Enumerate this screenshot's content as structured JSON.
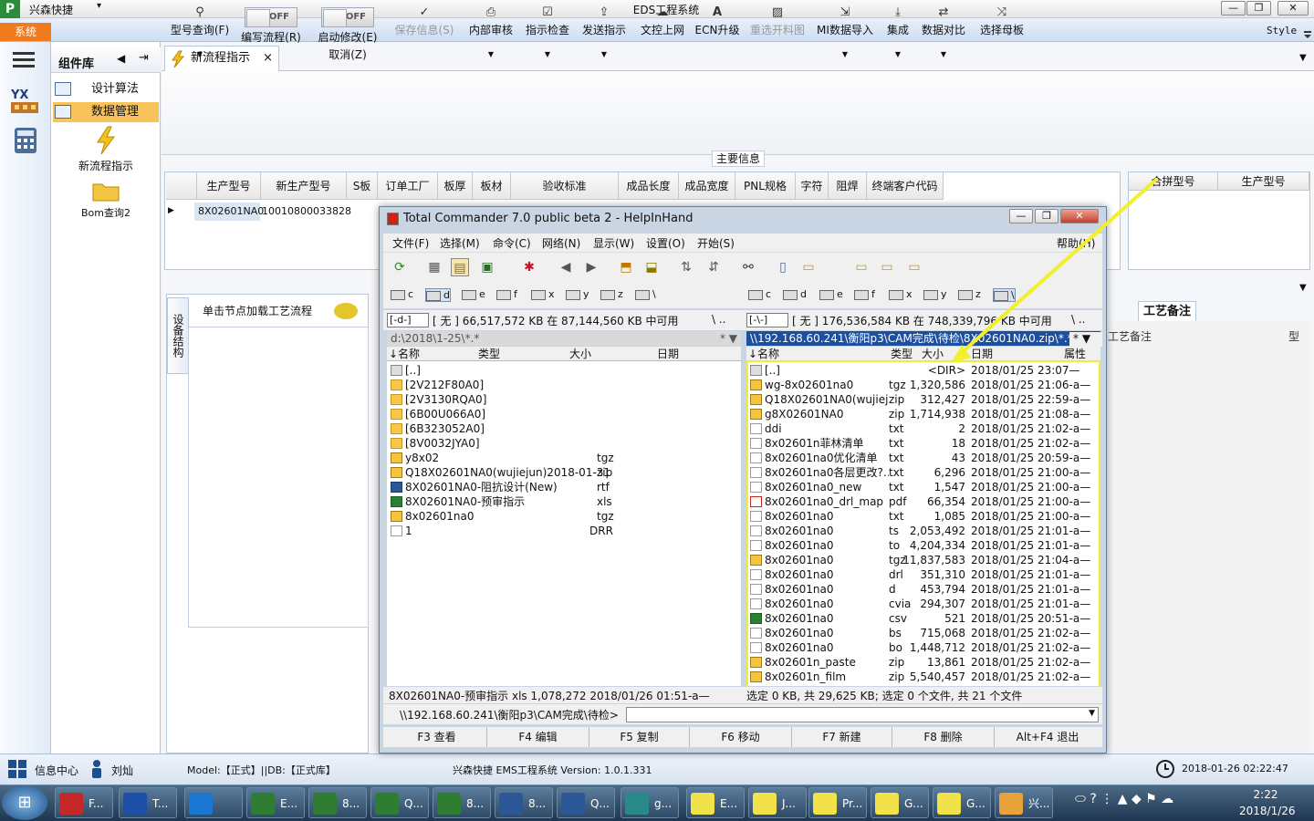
{
  "app": {
    "name": "兴森快捷",
    "window_title": "EDS工程系统",
    "qat": "▾",
    "system_tab": "系统",
    "style_label": "Style"
  },
  "window_buttons": {
    "min": "—",
    "max": "❐",
    "close": "✕"
  },
  "component_panel": {
    "title": "组件库",
    "items": [
      {
        "label": "设计算法"
      },
      {
        "label": "数据管理"
      }
    ],
    "big_items": [
      {
        "label": "新流程指示"
      },
      {
        "label": "Bom查询2"
      }
    ]
  },
  "doc_tab": {
    "label": "新流程指示",
    "close": "×"
  },
  "ribbon": {
    "items": [
      {
        "icon": "search-icon",
        "label": "型号查询(F)"
      },
      {
        "icon": "toggle",
        "label": "编写流程(R)",
        "toggle": "OFF"
      },
      {
        "icon": "toggle",
        "label": "启动修改(E)",
        "label2": "取消(Z)",
        "toggle": "OFF"
      },
      {
        "icon": "check-icon",
        "label": "保存信息(S)"
      },
      {
        "icon": "printer-icon",
        "label": "内部审核"
      },
      {
        "icon": "checkbox-icon",
        "label": "指示检查"
      },
      {
        "icon": "upload-icon",
        "label": "发送指示"
      },
      {
        "icon": "cloud-upload-icon",
        "label": "文控上网"
      },
      {
        "icon": "font-icon",
        "label": "ECN升级"
      },
      {
        "icon": "image-icon",
        "label": "重选开料图"
      },
      {
        "icon": "import-icon",
        "label": "MI数据导入"
      },
      {
        "icon": "download-icon",
        "label": "集成"
      },
      {
        "icon": "compare-icon",
        "label": "数据对比"
      },
      {
        "icon": "shuffle-icon",
        "label": "选择母板"
      }
    ]
  },
  "main_info_label": "主要信息",
  "grid": {
    "headers": [
      "生产型号",
      "新生产型号",
      "S板",
      "订单工厂",
      "板厚",
      "板材",
      "验收标准",
      "成品长度",
      "成品宽度",
      "PNL规格",
      "字符",
      "阻焊",
      "终端客户代码"
    ],
    "row": [
      "8X02601NA0",
      "10010800033828"
    ]
  },
  "right_grid": {
    "headers": [
      "合拼型号",
      "生产型号"
    ]
  },
  "lower": {
    "vertical_tab": "设备结构",
    "hint": "单击节点加载工艺流程",
    "process_tab": "工艺备注",
    "remark_label": "工艺备注",
    "xing": "型"
  },
  "status": {
    "info_center": "信息中心",
    "user": "刘灿",
    "model": "Model:【正式】||DB:【正式库】",
    "version": "兴森快捷 EMS工程系统 Version: 1.0.1.331",
    "datetime": "2018-01-26 02:22:47"
  },
  "tc": {
    "title": "Total Commander 7.0 public beta 2 - HelpInHand",
    "menu": [
      "文件(F)",
      "选择(M)",
      "命令(C)",
      "网络(N)",
      "显示(W)",
      "设置(O)",
      "开始(S)"
    ],
    "help": "帮助(H)",
    "drives_left": [
      "c",
      "d",
      "e",
      "f",
      "x",
      "y",
      "z",
      "\\"
    ],
    "drives_right": [
      "c",
      "d",
      "e",
      "f",
      "x",
      "y",
      "z",
      "\\"
    ],
    "left": {
      "drive": "[-d-]",
      "free": "[ 无 ]  66,517,572 KB 在 87,144,560 KB 中可用",
      "path": "d:\\2018\\1-25\\*.*",
      "columns": [
        "↓名称",
        "类型",
        "大小",
        "日期"
      ],
      "files": [
        {
          "icon": "up",
          "name": "[..]",
          "ext": ""
        },
        {
          "icon": "fold",
          "name": "[2V212F80A0]",
          "ext": ""
        },
        {
          "icon": "fold",
          "name": "[2V3130RQA0]",
          "ext": ""
        },
        {
          "icon": "fold",
          "name": "[6B00U066A0]",
          "ext": ""
        },
        {
          "icon": "fold",
          "name": "[6B323052A0]",
          "ext": ""
        },
        {
          "icon": "fold",
          "name": "[8V0032JYA0]",
          "ext": ""
        },
        {
          "icon": "arch",
          "name": "y8x02",
          "ext": "tgz"
        },
        {
          "icon": "arch",
          "name": "Q18X02601NA0(wujiejun)2018-01-31",
          "ext": "zip"
        },
        {
          "icon": "doc",
          "name": "8X02601NA0-阻抗设计(New)",
          "ext": "rtf"
        },
        {
          "icon": "xls",
          "name": "8X02601NA0-预审指示",
          "ext": "xls"
        },
        {
          "icon": "arch",
          "name": "8x02601na0",
          "ext": "tgz"
        },
        {
          "icon": "txt",
          "name": "1",
          "ext": "DRR"
        }
      ],
      "status": "8X02601NA0-预审指示        xls   1,078,272  2018/01/26  01:51-a—"
    },
    "right": {
      "drive": "[-\\-]",
      "free": "[ 无 ]  176,536,584 KB 在 748,339,796 KB 中可用",
      "path": "\\\\192.168.60.241\\衡阳p3\\CAM完成\\待检\\8X02601NA0.zip\\*.*",
      "columns": [
        "↓名称",
        "类型",
        "大小",
        "日期",
        "属性"
      ],
      "files": [
        {
          "icon": "up",
          "name": "[..]",
          "ext": "",
          "size": "<DIR>",
          "date": "2018/01/25 23:07—"
        },
        {
          "icon": "arch",
          "name": "wg-8x02601na0",
          "ext": "tgz",
          "size": "1,320,586",
          "date": "2018/01/25 21:06-a—"
        },
        {
          "icon": "arch",
          "name": "Q18X02601NA0(wujiej…",
          "ext": "zip",
          "size": "312,427",
          "date": "2018/01/25 22:59-a—"
        },
        {
          "icon": "arch",
          "name": "g8X02601NA0",
          "ext": "zip",
          "size": "1,714,938",
          "date": "2018/01/25 21:08-a—"
        },
        {
          "icon": "txt",
          "name": "ddi",
          "ext": "txt",
          "size": "2",
          "date": "2018/01/25 21:02-a—"
        },
        {
          "icon": "txt",
          "name": "8x02601n菲林清单",
          "ext": "txt",
          "size": "18",
          "date": "2018/01/25 21:02-a—"
        },
        {
          "icon": "txt",
          "name": "8x02601na0优化清单",
          "ext": "txt",
          "size": "43",
          "date": "2018/01/25 20:59-a—"
        },
        {
          "icon": "txt",
          "name": "8x02601na0各层更改?…",
          "ext": "txt",
          "size": "6,296",
          "date": "2018/01/25 21:00-a—"
        },
        {
          "icon": "txt",
          "name": "8x02601na0_new",
          "ext": "txt",
          "size": "1,547",
          "date": "2018/01/25 21:00-a—"
        },
        {
          "icon": "pdf",
          "name": "8x02601na0_drl_map",
          "ext": "pdf",
          "size": "66,354",
          "date": "2018/01/25 21:00-a—"
        },
        {
          "icon": "txt",
          "name": "8x02601na0",
          "ext": "txt",
          "size": "1,085",
          "date": "2018/01/25 21:00-a—"
        },
        {
          "icon": "txt",
          "name": "8x02601na0",
          "ext": "ts",
          "size": "2,053,492",
          "date": "2018/01/25 21:01-a—"
        },
        {
          "icon": "txt",
          "name": "8x02601na0",
          "ext": "to",
          "size": "4,204,334",
          "date": "2018/01/25 21:01-a—"
        },
        {
          "icon": "arch",
          "name": "8x02601na0",
          "ext": "tgz",
          "size": "11,837,583",
          "date": "2018/01/25 21:04-a—"
        },
        {
          "icon": "txt",
          "name": "8x02601na0",
          "ext": "drl",
          "size": "351,310",
          "date": "2018/01/25 21:01-a—"
        },
        {
          "icon": "txt",
          "name": "8x02601na0",
          "ext": "d",
          "size": "453,794",
          "date": "2018/01/25 21:01-a—"
        },
        {
          "icon": "txt",
          "name": "8x02601na0",
          "ext": "cvia",
          "size": "294,307",
          "date": "2018/01/25 21:01-a—"
        },
        {
          "icon": "xls",
          "name": "8x02601na0",
          "ext": "csv",
          "size": "521",
          "date": "2018/01/25 20:51-a—"
        },
        {
          "icon": "txt",
          "name": "8x02601na0",
          "ext": "bs",
          "size": "715,068",
          "date": "2018/01/25 21:02-a—"
        },
        {
          "icon": "txt",
          "name": "8x02601na0",
          "ext": "bo",
          "size": "1,448,712",
          "date": "2018/01/25 21:02-a—"
        },
        {
          "icon": "arch",
          "name": "8x02601n_paste",
          "ext": "zip",
          "size": "13,861",
          "date": "2018/01/25 21:02-a—"
        },
        {
          "icon": "arch",
          "name": "8x02601n_film",
          "ext": "zip",
          "size": "5,540,457",
          "date": "2018/01/25 21:02-a—"
        }
      ],
      "status": "选定 0 KB, 共 29,625 KB; 选定 0 个文件, 共 21 个文件"
    },
    "cmd_path": "\\\\192.168.60.241\\衡阳p3\\CAM完成\\待检>",
    "fkeys": [
      "F3 查看",
      "F4 编辑",
      "F5 复制",
      "F6 移动",
      "F7 新建",
      "F8 删除",
      "Alt+F4 退出"
    ]
  },
  "taskbar": {
    "items": [
      {
        "label": "F...",
        "color": "#c62828"
      },
      {
        "label": "T...",
        "color": "#1e4fa8"
      },
      {
        "label": "",
        "color": "#1976d2"
      },
      {
        "label": "E...",
        "color": "#2e7d32"
      },
      {
        "label": "8...",
        "color": "#2e7d32"
      },
      {
        "label": "Q...",
        "color": "#2e7d32"
      },
      {
        "label": "8...",
        "color": "#2e7d32"
      },
      {
        "label": "8...",
        "color": "#2b5797"
      },
      {
        "label": "Q...",
        "color": "#2b5797"
      },
      {
        "label": "g...",
        "color": "#2a8a8a"
      },
      {
        "label": "E...",
        "color": "#f2e24a"
      },
      {
        "label": "J...",
        "color": "#f2e24a"
      },
      {
        "label": "Pr...",
        "color": "#f2e24a"
      },
      {
        "label": "G...",
        "color": "#f2e24a"
      },
      {
        "label": "G...",
        "color": "#f2e24a"
      },
      {
        "label": "兴...",
        "color": "#e8a23a"
      }
    ],
    "time": "2:22",
    "date": "2018/1/26"
  }
}
